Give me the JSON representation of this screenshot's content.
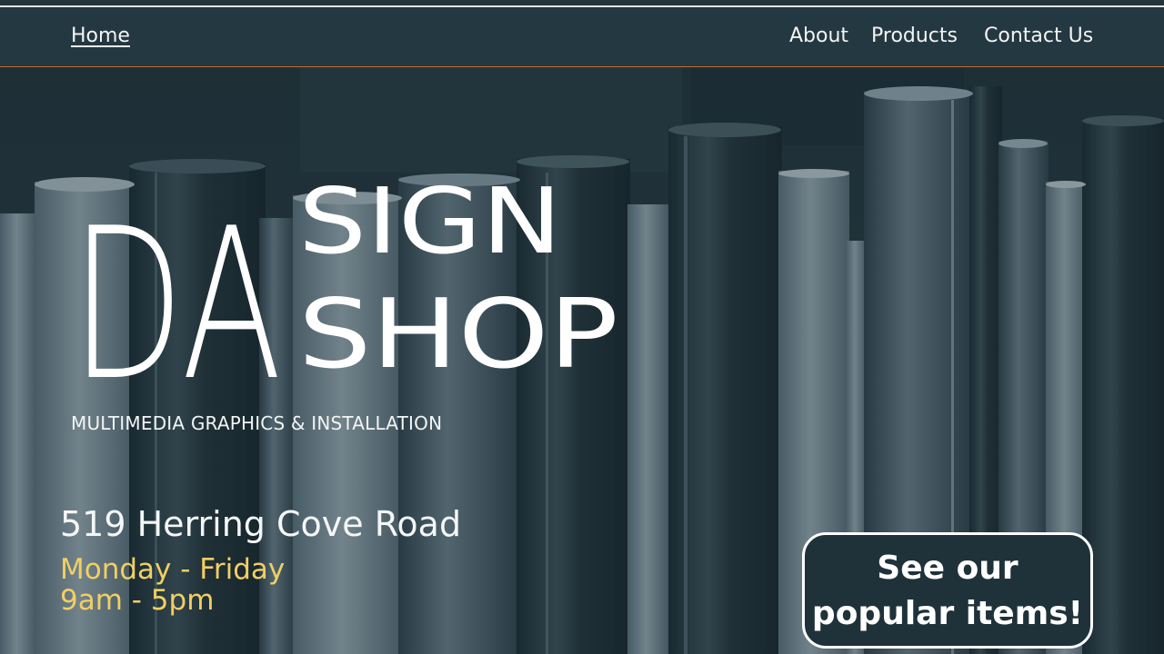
{
  "nav": {
    "home": "Home",
    "about": "About",
    "products": "Products",
    "contact": "Contact Us"
  },
  "hero": {
    "logo_da": "DA",
    "logo_sign": "SIGN",
    "logo_shop": "SHOP",
    "tagline": "MULTIMEDIA GRAPHICS & INSTALLATION",
    "address": "519 Herring Cove Road",
    "hours_days": "Monday - Friday",
    "hours_time": "9am - 5pm",
    "cta_line1": "See our",
    "cta_line2": "popular items!"
  },
  "colors": {
    "nav_bg": "#243841",
    "accent_border": "#c26a2e",
    "hours_text": "#f2cf64",
    "cta_bg": "#1f323a"
  }
}
